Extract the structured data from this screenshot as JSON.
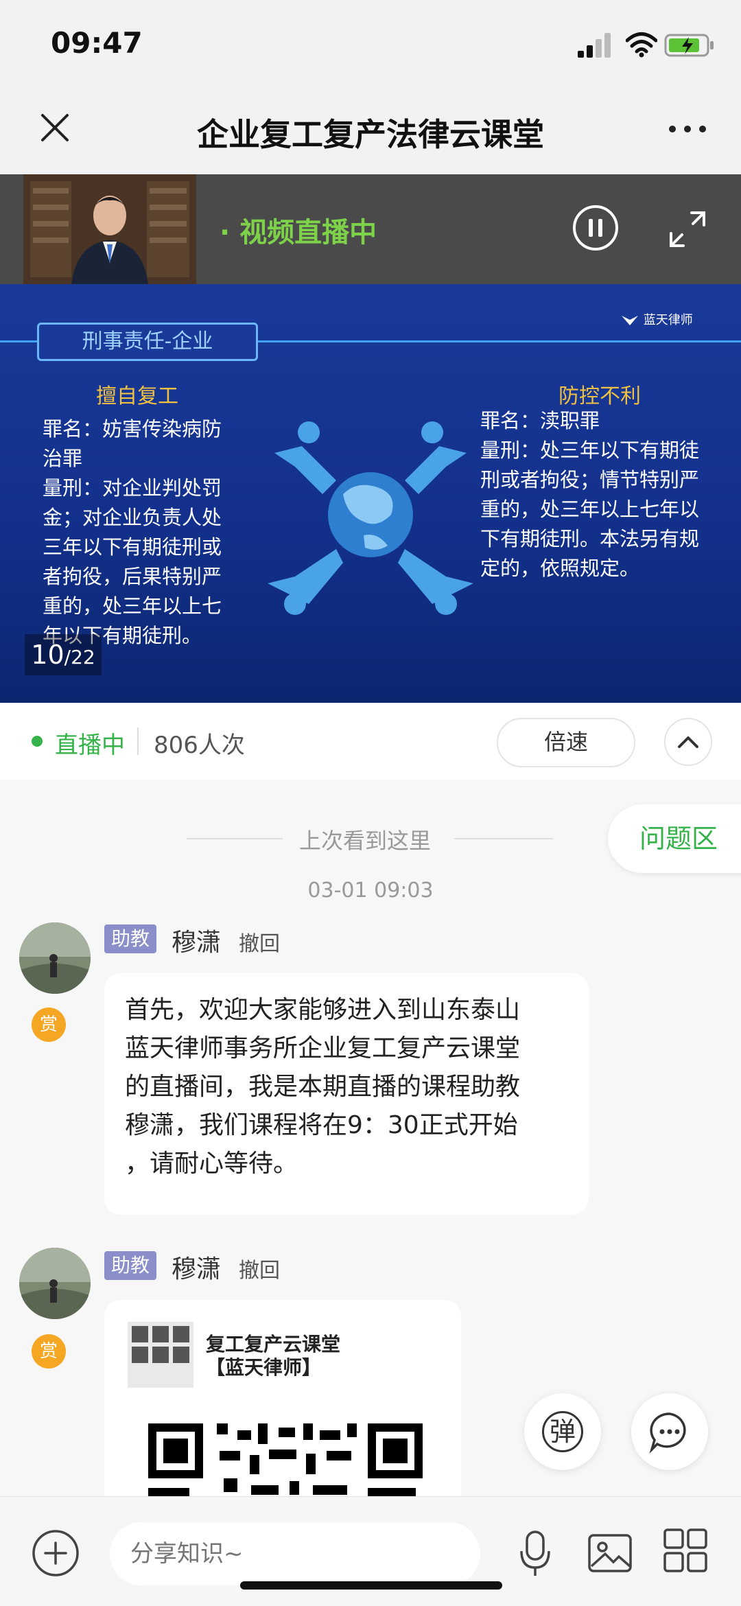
{
  "status_bar": {
    "time": "09:47"
  },
  "header": {
    "title": "企业复工复产法律云课堂"
  },
  "video": {
    "live_label": "· 视频直播中"
  },
  "slide": {
    "tag": "刑事责任-企业",
    "logo": "蓝天律师",
    "left_title": "擅自复工",
    "left_lines": [
      "罪名：妨害传染病防",
      "治罪",
      "量刑：对企业判处罚",
      "金；对企业负责人处",
      "三年以下有期徒刑或",
      "者拘役，后果特别严",
      "重的，处三年以上七",
      "年以下有期徒刑。"
    ],
    "right_title": "防控不利",
    "right_lines": [
      "罪名：渎职罪",
      "量刑：处三年以下有期徒",
      "刑或者拘役；情节特别严",
      "重的，处三年以上七年以",
      "下有期徒刑。本法另有规",
      "定的，依照规定。"
    ],
    "page_current": "10",
    "page_total": "/22"
  },
  "live_status": {
    "label": "直播中",
    "views": "806人次",
    "speed_label": "倍速"
  },
  "chat": {
    "divider_text": "上次看到这里",
    "timestamp": "03-01 09:03",
    "qa_label": "问题区",
    "messages": [
      {
        "role": "助教",
        "name": "穆潇",
        "recall": "撤回",
        "reward": "赏",
        "text_lines": [
          "首先，欢迎大家能够进入到山东泰山",
          "蓝天律师事务所企业复工复产云课堂",
          "的直播间，我是本期直播的课程助教",
          "穆潇，我们课程将在9：30正式开始",
          "，请耐心等待。"
        ]
      },
      {
        "role": "助教",
        "name": "穆潇",
        "recall": "撤回",
        "reward": "赏",
        "card_title_1": "复工复产云课堂",
        "card_title_2": "【蓝天律师】"
      }
    ],
    "danmu_label": "弹"
  },
  "composer": {
    "placeholder": "分享知识~"
  },
  "colors": {
    "accent_green": "#35b34a",
    "live_green": "#7ed24a",
    "slide_blue": "#1a3a9a",
    "role_badge": "#8b8fc9",
    "reward": "#f5a623"
  },
  "icons": [
    "close-icon",
    "more-icon",
    "pause-icon",
    "fullscreen-icon",
    "chevron-up-icon",
    "chat-icon",
    "plus-icon",
    "mic-icon",
    "image-icon",
    "apps-icon",
    "signal-icon",
    "wifi-icon",
    "battery-icon"
  ]
}
